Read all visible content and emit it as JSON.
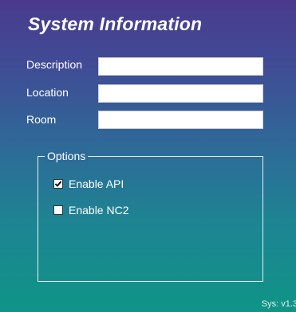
{
  "window": {
    "title": "System Information"
  },
  "fields": [
    {
      "label": "Description",
      "value": ""
    },
    {
      "label": "Location",
      "value": ""
    },
    {
      "label": "Room",
      "value": ""
    }
  ],
  "options": {
    "legend": "Options",
    "items": [
      {
        "label": "Enable API",
        "checked": true
      },
      {
        "label": "Enable NC2",
        "checked": false
      }
    ]
  },
  "footer": {
    "version": "Sys: v1.3"
  },
  "colors": {
    "gradient_top": "#4a3a8e",
    "gradient_bottom": "#0f9487",
    "text": "#ffffff"
  }
}
